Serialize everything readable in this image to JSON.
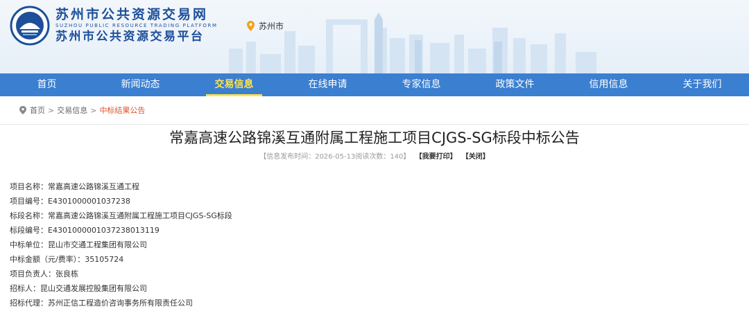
{
  "header": {
    "site_name_cn": "苏州市公共资源交易网",
    "site_name_en": "SUZHOU PUBLIC RESOURCE TRADING PLATFORM",
    "platform_name_cn": "苏州市公共资源交易平台",
    "location": "苏州市",
    "logo_icon": "suzhou-resource-logo",
    "pin_icon": "location-pin-icon"
  },
  "nav": {
    "items": [
      {
        "label": "首页"
      },
      {
        "label": "新闻动态"
      },
      {
        "label": "交易信息"
      },
      {
        "label": "在线申请"
      },
      {
        "label": "专家信息"
      },
      {
        "label": "政策文件"
      },
      {
        "label": "信用信息"
      },
      {
        "label": "关于我们"
      }
    ],
    "active": "交易信息"
  },
  "breadcrumb": {
    "home": "首页",
    "sep1": ">",
    "level2": "交易信息",
    "sep2": ">",
    "current": "中标结果公告"
  },
  "article": {
    "title": "常嘉高速公路锦溪互通附属工程施工项目CJGS-SG标段中标公告",
    "meta_info": "【信息发布时间：2026-05-13阅读次数：140】",
    "print_label": "【我要打印】",
    "close_label": "【关闭】",
    "fields": [
      "项目名称：常嘉高速公路锦溪互通工程",
      "项目编号：E4301000001037238",
      "标段名称：常嘉高速公路锦溪互通附属工程施工项目CJGS-SG标段",
      "标段编号：E4301000001037238013119",
      "中标单位：昆山市交通工程集团有限公司",
      "中标金额（元/费率）：35105724",
      "项目负责人：张良栋",
      "招标人：昆山交通发展控股集团有限公司",
      "招标代理：苏州正信工程造价咨询事务所有限责任公司"
    ]
  },
  "colors": {
    "nav_bg": "#3b7fd0",
    "nav_active": "#ffe44d",
    "brand_blue": "#1d4f9a",
    "breadcrumb_current": "#e0522c"
  }
}
